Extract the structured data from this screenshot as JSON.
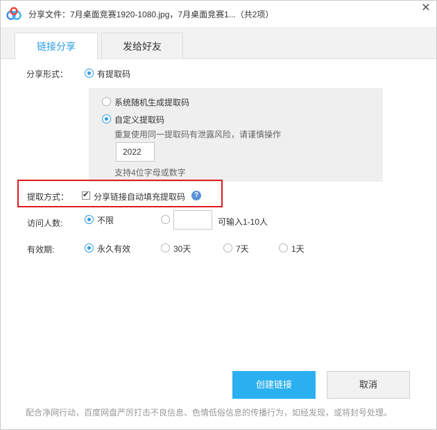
{
  "window": {
    "title": "分享文件：7月桌面竞赛1920-1080.jpg，7月桌面竞赛1...（共2项）",
    "close_glyph": "✕",
    "icon": "baidu-netdisk-logo"
  },
  "tabs": [
    {
      "label": "链接分享",
      "active": true
    },
    {
      "label": "发给好友",
      "active": false
    }
  ],
  "share_form": {
    "label": "分享形式：",
    "option": "有提取码",
    "selected": true
  },
  "code_box": {
    "random_option": "系统随机生成提取码",
    "custom_option": "自定义提取码",
    "selected": "custom",
    "warning": "重复使用同一提取码有泄露风险，请谨慎操作",
    "code_value": "2022",
    "hint": "支持4位字母或数字"
  },
  "extract_method": {
    "label": "提取方式：",
    "checkbox_label": "分享链接自动填充提取码",
    "checked": true,
    "check_glyph": "✔",
    "help_glyph": "?"
  },
  "visitors": {
    "label": "访问人数:",
    "unlimited": "不限",
    "limit_hint": "可输入1-10人",
    "selected": "unlimited",
    "limit_value": ""
  },
  "validity": {
    "label": "有效期:",
    "options": [
      "永久有效",
      "30天",
      "7天",
      "1天"
    ],
    "selected_index": 0
  },
  "actions": {
    "create_label": "创建链接",
    "cancel_label": "取消"
  },
  "footer": "配合净网行动，百度网盘严厉打击不良信息、色情低俗信息的传播行为，如经发现，或将封号处理。",
  "colors": {
    "accent": "#2a9ee8",
    "primary_button": "#2ab0f0",
    "highlight_border": "#e0191d"
  }
}
